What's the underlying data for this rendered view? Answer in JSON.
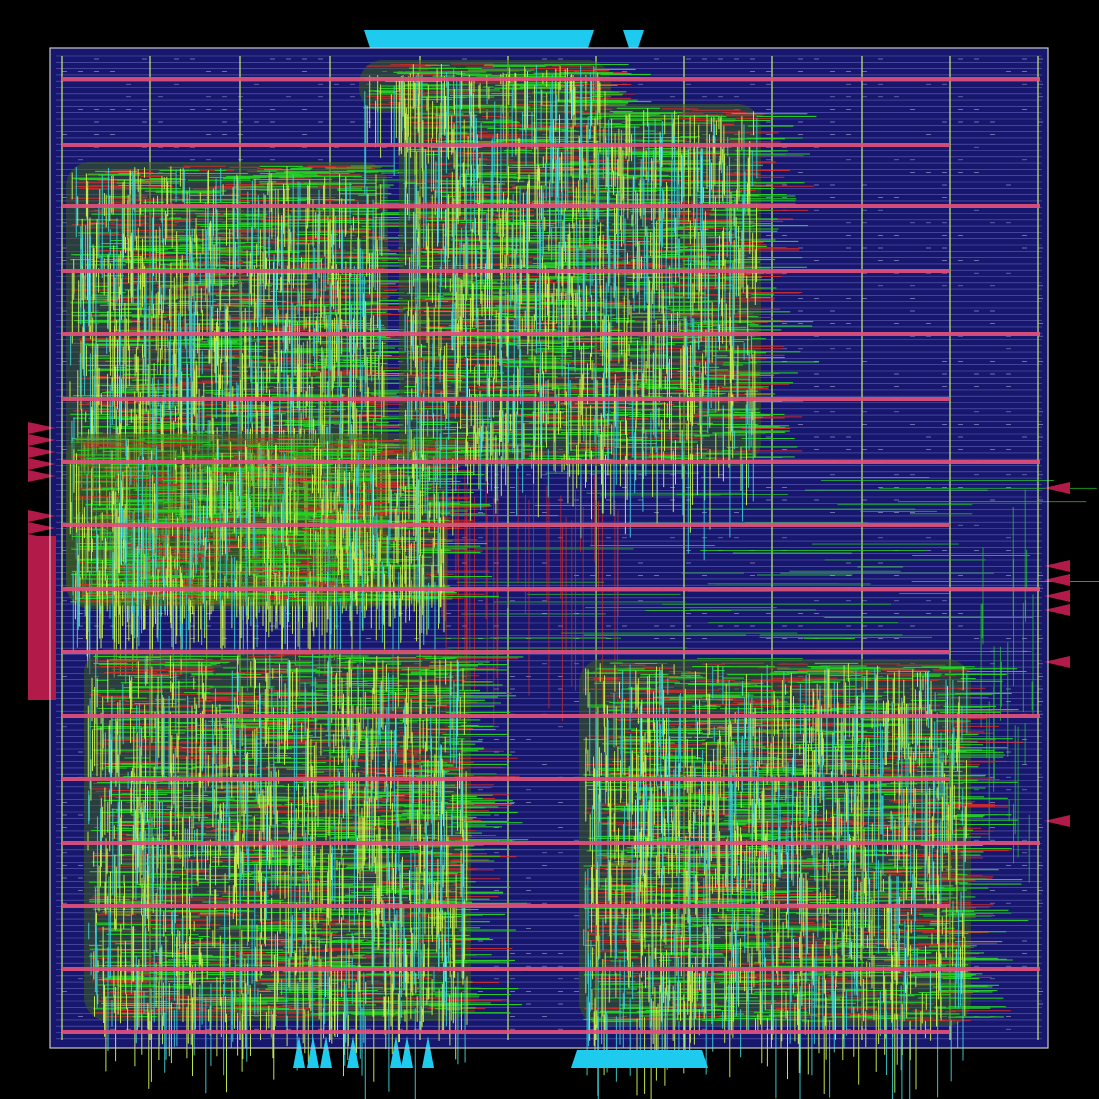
{
  "view": {
    "kind": "chip layout view",
    "background": "#000000",
    "die_outline_color": "#c8c8c8",
    "core_fill_color": "#17176e",
    "row_line_color": "#7a7ad6"
  },
  "layers": [
    {
      "name": "metal-1",
      "color": "#d42a2a"
    },
    {
      "name": "metal-2",
      "color": "#23d323"
    },
    {
      "name": "metal-3",
      "color": "#c8f050"
    },
    {
      "name": "metal-4",
      "color": "#3ad0d6"
    },
    {
      "name": "power-rail-horizontal",
      "color": "#e0507a"
    },
    {
      "name": "power-rail-vertical",
      "color": "#b8e066"
    },
    {
      "name": "io-pin-left-right",
      "color": "#b21a4a"
    },
    {
      "name": "io-pin-top-bottom",
      "color": "#1ecbef"
    }
  ],
  "blocks": [
    {
      "name": "logic-cluster-upper-left"
    },
    {
      "name": "logic-cluster-upper-middle"
    },
    {
      "name": "logic-cluster-lower-left"
    },
    {
      "name": "logic-cluster-lower-right"
    }
  ]
}
